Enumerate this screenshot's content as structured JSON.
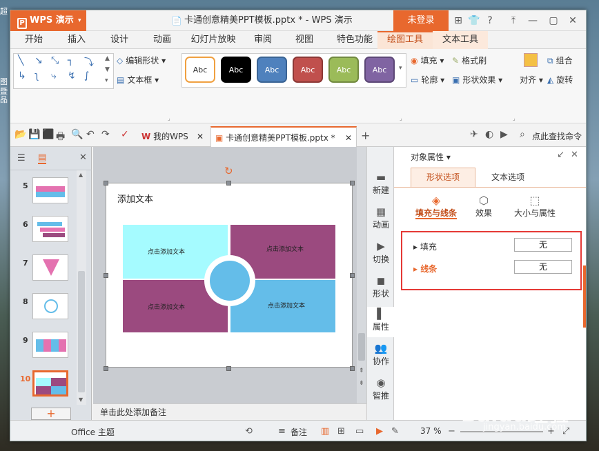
{
  "desktop": {
    "left_text": [
      "超",
      "图",
      "暨",
      "品"
    ]
  },
  "titlebar": {
    "app_button": "WPS 演示",
    "doc_title": "卡通创意精美PPT模板.pptx * - WPS 演示",
    "login": "未登录",
    "help": "?"
  },
  "ribbon_tabs": [
    "开始",
    "插入",
    "设计",
    "动画",
    "幻灯片放映",
    "审阅",
    "视图",
    "特色功能",
    "绘图工具",
    "文本工具"
  ],
  "ribbon": {
    "edit_shape": "编辑形状",
    "text_box": "文本框",
    "fill": "填充",
    "format_painter": "格式刷",
    "outline": "轮廓",
    "shape_effects": "形状效果",
    "align": "对齐",
    "group": "组合",
    "rotate": "旋转",
    "style_label": "Abc",
    "styles": [
      {
        "bg": "#ffffff",
        "border": "#f0a040",
        "fg": "#333333"
      },
      {
        "bg": "#000000",
        "border": "#000000",
        "fg": "#ffffff"
      },
      {
        "bg": "#4f81bd",
        "border": "#3a6494",
        "fg": "#ffffff"
      },
      {
        "bg": "#c0504d",
        "border": "#8c3836",
        "fg": "#ffffff"
      },
      {
        "bg": "#9bbb59",
        "border": "#71893f",
        "fg": "#ffffff"
      },
      {
        "bg": "#8064a2",
        "border": "#5c4776",
        "fg": "#ffffff"
      }
    ]
  },
  "doc_tabs": {
    "home": "我的WPS",
    "file": "卡通创意精美PPT模板.pptx *",
    "search": "点此查找命令"
  },
  "thumbnails": [
    {
      "num": "5"
    },
    {
      "num": "6"
    },
    {
      "num": "7"
    },
    {
      "num": "8"
    },
    {
      "num": "9"
    },
    {
      "num": "10"
    }
  ],
  "slide": {
    "title": "添加文本",
    "cells": [
      "点击添加文本",
      "点击添加文本",
      "点击添加文本",
      "点击添加文本"
    ],
    "colors": {
      "cyan": "#a5fbff",
      "purple": "#9b4a7f",
      "blue": "#64bde9"
    }
  },
  "notes": "单击此处添加备注",
  "sidebar": [
    "新建",
    "动画",
    "切换",
    "形状",
    "属性",
    "协作",
    "智推"
  ],
  "panel": {
    "title": "对象属性",
    "tabs": [
      "形状选项",
      "文本选项"
    ],
    "subtabs": [
      "填充与线条",
      "效果",
      "大小与属性"
    ],
    "fill_label": "填充",
    "fill_value": "无",
    "line_label": "线条",
    "line_value": "无"
  },
  "status": {
    "theme": "Office 主题",
    "notes_btn": "备注",
    "zoom": "37 %"
  },
  "watermark": {
    "brand": "Baidu经验",
    "url": "jingyan.baidu.com"
  }
}
